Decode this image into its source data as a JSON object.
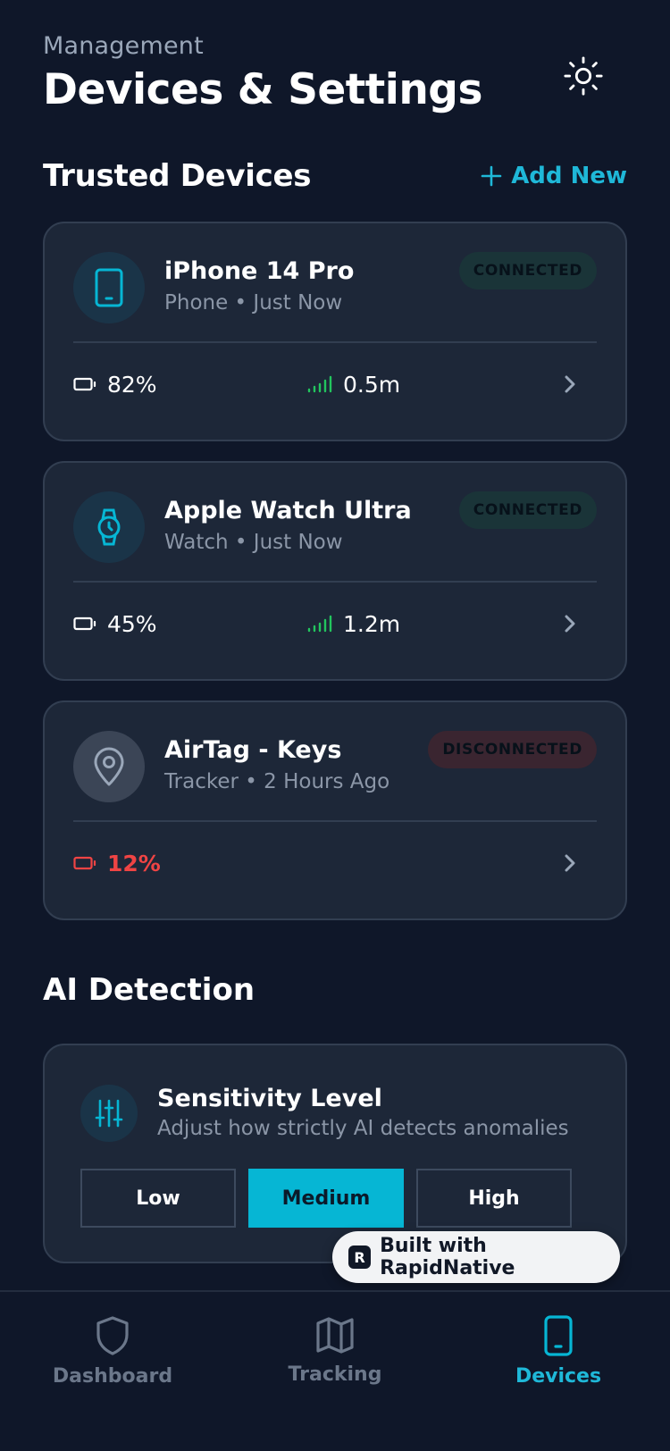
{
  "header": {
    "eyebrow": "Management",
    "title": "Devices & Settings"
  },
  "trusted": {
    "title": "Trusted Devices",
    "add_label": "Add New"
  },
  "devices": [
    {
      "name": "iPhone 14 Pro",
      "meta": "Phone • Just Now",
      "status": "CONNECTED",
      "battery": "82%",
      "signal": "0.5m",
      "icon": "phone-icon"
    },
    {
      "name": "Apple Watch Ultra",
      "meta": "Watch • Just Now",
      "status": "CONNECTED",
      "battery": "45%",
      "signal": "1.2m",
      "icon": "watch-icon"
    },
    {
      "name": "AirTag - Keys",
      "meta": "Tracker • 2 Hours Ago",
      "status": "DISCONNECTED",
      "battery": "12%",
      "icon": "location-pin-icon"
    }
  ],
  "ai": {
    "title": "AI Detection",
    "sensitivity": {
      "title": "Sensitivity Level",
      "desc": "Adjust how strictly AI detects anomalies",
      "options": [
        "Low",
        "Medium",
        "High"
      ],
      "selected": "Medium"
    }
  },
  "banner": {
    "label": "Built with RapidNative"
  },
  "tabs": [
    {
      "label": "Dashboard",
      "icon": "shield-icon"
    },
    {
      "label": "Tracking",
      "icon": "map-icon"
    },
    {
      "label": "Devices",
      "icon": "phone-icon",
      "active": true
    }
  ],
  "colors": {
    "background": "#0f1729",
    "card": "#1d2738",
    "accent": "#06b6d4",
    "success": "#22c55e",
    "danger": "#ef4444"
  }
}
